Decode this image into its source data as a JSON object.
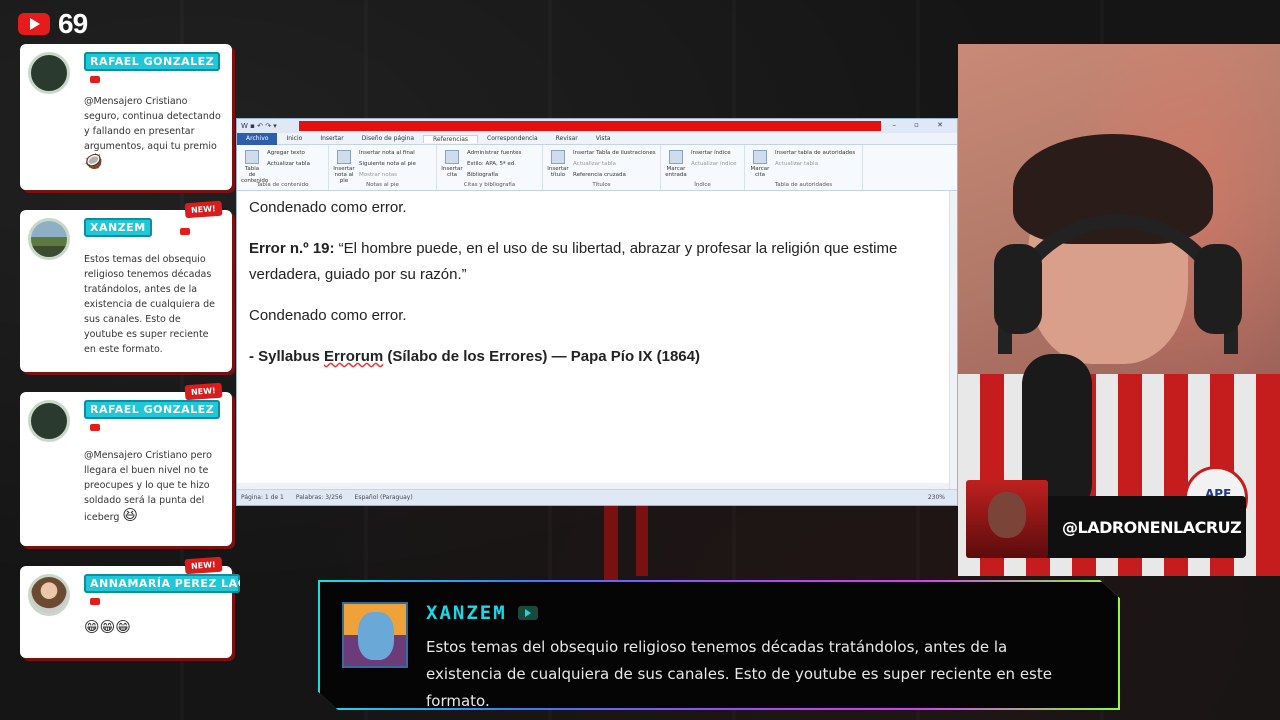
{
  "stream": {
    "viewer_count": "69",
    "handle": "@LADRONENLACRUZ"
  },
  "chat": [
    {
      "name": "RAFAEL GONZALEZ",
      "badge": "",
      "message": "@Mensajero Cristiano seguro, continua detectando y fallando en presentar argumentos, aqui tu premio",
      "emoji": "🥥"
    },
    {
      "name": "XANZEM",
      "badge": "NEW!",
      "message": "Estos temas del obsequio religioso tenemos décadas tratándolos, antes de la existencia de cualquiera de sus canales. Esto de youtube es super reciente en este formato.",
      "emoji": ""
    },
    {
      "name": "RAFAEL GONZALEZ",
      "badge": "NEW!",
      "message": "@Mensajero Cristiano pero llegara el buen nivel no te preocupes y lo que te hizo soldado será la punta del iceberg",
      "emoji": "😆"
    },
    {
      "name": "ANNAMARÍA PEREZ LACH",
      "badge": "NEW!",
      "message": "",
      "emoji": "😁😁😁"
    }
  ],
  "word": {
    "tabs": [
      "Archivo",
      "Inicio",
      "Insertar",
      "Diseño de página",
      "Referencias",
      "Correspondencia",
      "Revisar",
      "Vista"
    ],
    "ribbon": {
      "toc": {
        "big": "Tabla de contenido",
        "add_text": "Agregar texto",
        "update": "Actualizar tabla",
        "group": "Tabla de contenido"
      },
      "footnotes": {
        "big": "Insertar nota al pie",
        "endnote": "Insertar nota al final",
        "next": "Siguiente nota al pie",
        "show": "Mostrar notas",
        "group": "Notas al pie"
      },
      "citations": {
        "big": "Insertar cita",
        "manage": "Administrar fuentes",
        "style_label": "Estilo:",
        "style_value": "APA, 5ª ed.",
        "bib": "Bibliografía",
        "group": "Citas y bibliografía"
      },
      "captions": {
        "big": "Insertar título",
        "figures": "Insertar Tabla de ilustraciones",
        "update": "Actualizar tabla",
        "cross": "Referencia cruzada",
        "group": "Títulos"
      },
      "index": {
        "big": "Marcar entrada",
        "insert": "Insertar índice",
        "update": "Actualizar índice",
        "group": "Índice"
      },
      "authorities": {
        "big": "Marcar cita",
        "insert": "Insertar tabla de autoridades",
        "update": "Actualizar tabla",
        "group": "Tabla de autoridades"
      }
    },
    "doc": {
      "p1": "Condenado como error.",
      "error_label": "Error n.º 19:",
      "error_text": " “El hombre puede, en el uso de su libertad, abrazar y profesar la religión que estime verdadera, guiado por su razón.”",
      "p3": "Condenado como error.",
      "src_a": "- Syllabus ",
      "src_b": "Errorum",
      "src_c": " (Sílabo de los Errores) — Papa Pío IX (1864)"
    },
    "status": {
      "page": "Página: 1 de 1",
      "words": "Palabras: 3/256",
      "lang": "Español (Paraguay)",
      "zoom": "230%"
    }
  },
  "featured": {
    "name": "XANZEM",
    "message": "Estos temas del obsequio religioso tenemos décadas tratándolos, antes de la existencia de cualquiera de sus canales. Esto de youtube es super reciente en este formato."
  },
  "webcam": {
    "shirt_badge": "APF"
  },
  "colors": {
    "accent_cyan": "#20c7d8",
    "accent_red": "#e61b1b",
    "dark_red": "#7a1010"
  }
}
